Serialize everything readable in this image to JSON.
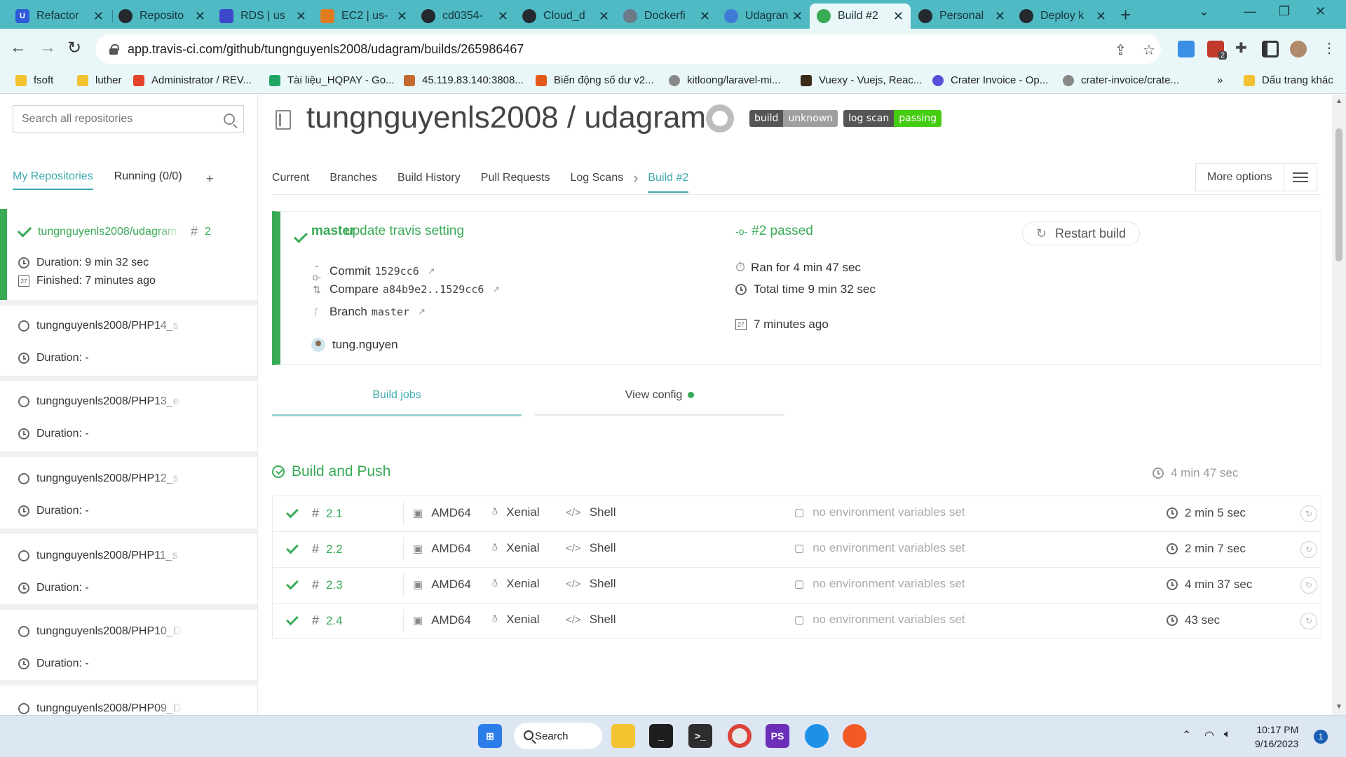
{
  "browser": {
    "tabs": [
      {
        "label": "Refactor",
        "color": "#2d5bd7"
      },
      {
        "label": "Reposito",
        "color": "#24292f"
      },
      {
        "label": "RDS | us",
        "color": "#3b48cc"
      },
      {
        "label": "EC2 | us-",
        "color": "#e07b1f"
      },
      {
        "label": "cd0354-",
        "color": "#24292f"
      },
      {
        "label": "Cloud_d",
        "color": "#24292f"
      },
      {
        "label": "Dockerfi",
        "color": "#6c7a89"
      },
      {
        "label": "Udagran",
        "color": "#3e7bd6"
      },
      {
        "label": "Build #2",
        "color": "#39aa56"
      },
      {
        "label": "Personal",
        "color": "#24292f"
      },
      {
        "label": "Deploy k",
        "color": "#24292f"
      }
    ],
    "url": "app.travis-ci.com/github/tungnguyenls2008/udagram/builds/265986467",
    "ext_badge": "2",
    "bookmarks": [
      {
        "label": "fsoft",
        "color": "#f2c230"
      },
      {
        "label": "luther",
        "color": "#f2c230"
      },
      {
        "label": "Administrator / REV...",
        "color": "#e24329"
      },
      {
        "label": "Tài liệu_HQPAY - Go...",
        "color": "#1fa463"
      },
      {
        "label": "45.119.83.140:3808...",
        "color": "#c46a2e"
      },
      {
        "label": "Biến động số dư v2...",
        "color": "#e55a1c"
      },
      {
        "label": "kitloong/laravel-mi...",
        "color": "#888888"
      },
      {
        "label": "Vuexy - Vuejs, Reac...",
        "color": "#3a2a1a"
      },
      {
        "label": "Crater Invoice - Op...",
        "color": "#5851d8"
      },
      {
        "label": "crater-invoice/crate...",
        "color": "#888888"
      }
    ],
    "bookmarks_other": "Dấu trang khác",
    "bookmarks_more": "»"
  },
  "sidebar": {
    "search_placeholder": "Search all repositories",
    "tabs": {
      "my_repos": "My Repositories",
      "running": "Running (0/0)",
      "add": "+"
    },
    "repos": [
      {
        "name": "tungnguyenls2008/udagram",
        "hash": "#",
        "num": "2",
        "duration": "Duration: 9 min 32 sec",
        "finished": "Finished: 7 minutes ago"
      },
      {
        "name": "tungnguyenls2008/PHP14_s",
        "duration": "Duration: -"
      },
      {
        "name": "tungnguyenls2008/PHP13_e",
        "duration": "Duration: -"
      },
      {
        "name": "tungnguyenls2008/PHP12_s",
        "duration": "Duration: -"
      },
      {
        "name": "tungnguyenls2008/PHP11_s",
        "duration": "Duration: -"
      },
      {
        "name": "tungnguyenls2008/PHP10_D",
        "duration": "Duration: -"
      },
      {
        "name": "tungnguyenls2008/PHP09_D",
        "duration": ""
      }
    ]
  },
  "main": {
    "title": "tungnguyenls2008 / udagram",
    "badges": {
      "build_left": "build",
      "build_right": "unknown",
      "build_color": "#9f9f9f",
      "scan_left": "log scan",
      "scan_right": "passing",
      "scan_color": "#4c1"
    },
    "tabs": [
      "Current",
      "Branches",
      "Build History",
      "Pull Requests",
      "Log Scans",
      "Build #2"
    ],
    "more_options": "More options",
    "build": {
      "branch": "master",
      "message": "update travis setting",
      "commit_label": "Commit",
      "commit_sha": "1529cc6",
      "compare_label": "Compare",
      "compare_range": "a84b9e2..1529cc6",
      "branch_label": "Branch",
      "branch_name": "master",
      "author": "tung.nguyen",
      "state": "#2 passed",
      "ran_for": "Ran for 4 min 47 sec",
      "total_time": "Total time 9 min 32 sec",
      "finished_ago": "7 minutes ago",
      "restart": "Restart build"
    },
    "job_tabs": {
      "build_jobs": "Build jobs",
      "view_config": "View config"
    },
    "stage": {
      "name": "Build and Push",
      "time": "4 min 47 sec"
    },
    "jobs": [
      {
        "num": "2.1",
        "arch": "AMD64",
        "os": "Xenial",
        "lang": "Shell",
        "env": "no environment variables set",
        "time": "2 min 5 sec"
      },
      {
        "num": "2.2",
        "arch": "AMD64",
        "os": "Xenial",
        "lang": "Shell",
        "env": "no environment variables set",
        "time": "2 min 7 sec"
      },
      {
        "num": "2.3",
        "arch": "AMD64",
        "os": "Xenial",
        "lang": "Shell",
        "env": "no environment variables set",
        "time": "4 min 37 sec"
      },
      {
        "num": "2.4",
        "arch": "AMD64",
        "os": "Xenial",
        "lang": "Shell",
        "env": "no environment variables set",
        "time": "43 sec"
      }
    ]
  },
  "taskbar": {
    "search": "Search",
    "time": "10:17 PM",
    "date": "9/16/2023",
    "notifications": "1"
  },
  "colors": {
    "accent": "#3eaaaf",
    "passed": "#39aa56",
    "tabbar": "#4fb9c4"
  }
}
